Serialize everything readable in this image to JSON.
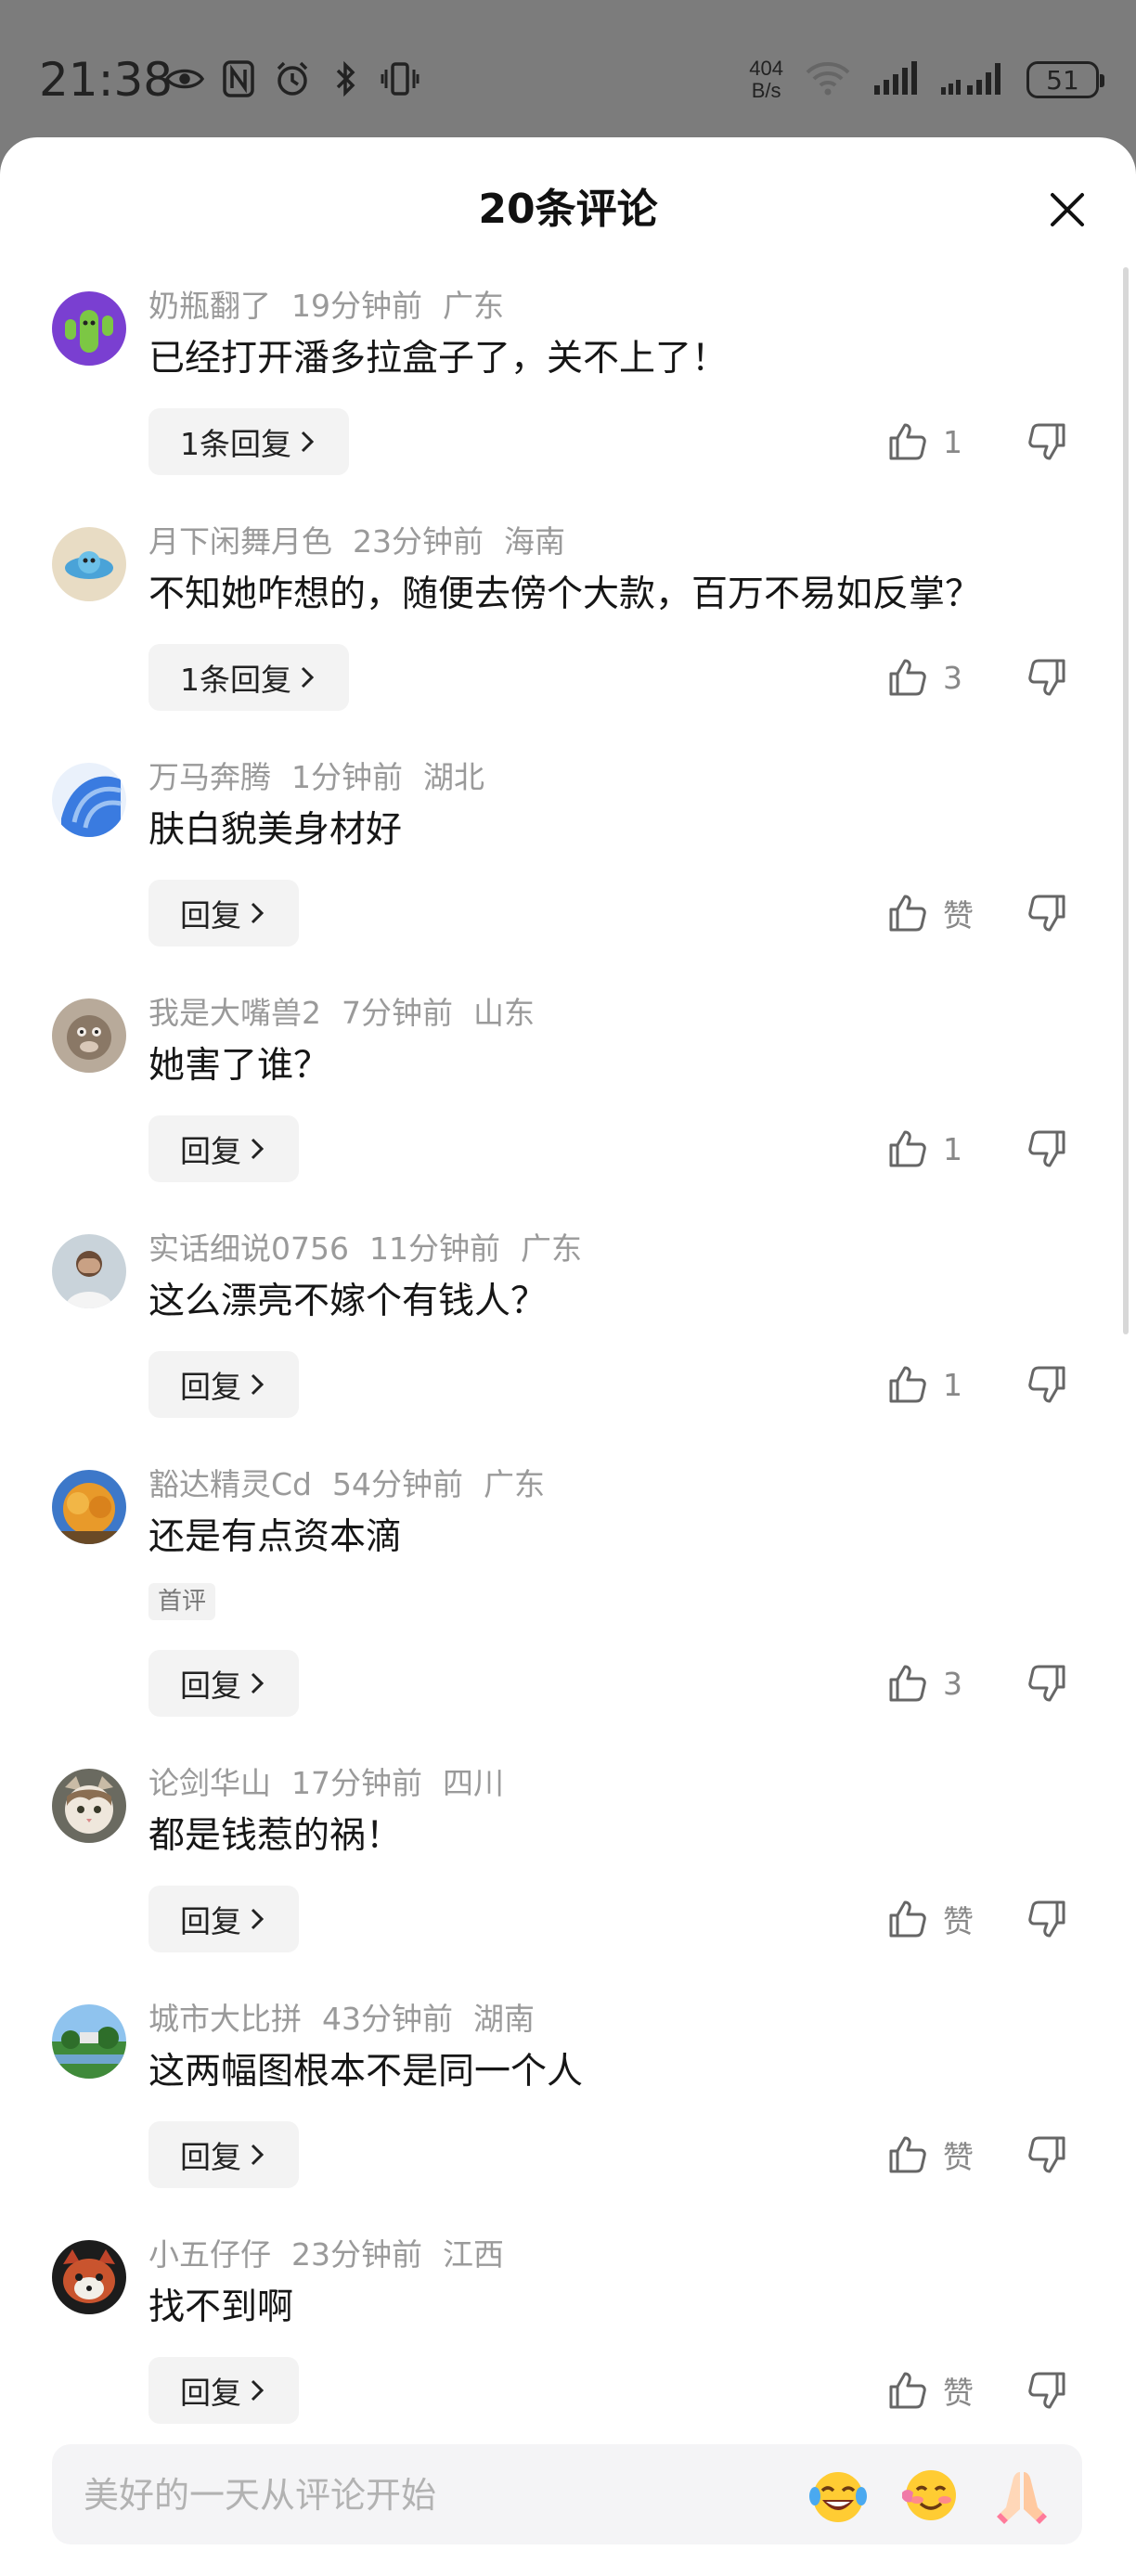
{
  "status_bar": {
    "time": "21:38",
    "net_speed_value": "404",
    "net_speed_unit": "B/s",
    "battery": "51"
  },
  "sheet": {
    "title": "20条评论",
    "input_placeholder": "美好的一天从评论开始"
  },
  "comments": [
    {
      "user": "奶瓶翻了",
      "time": "19分钟前",
      "region": "广东",
      "text": "已经打开潘多拉盒子了，关不上了！",
      "reply_label": "1条回复",
      "likes": "1"
    },
    {
      "user": "月下闲舞月色",
      "time": "23分钟前",
      "region": "海南",
      "text": "不知她咋想的，随便去傍个大款，百万不易如反掌？",
      "reply_label": "1条回复",
      "likes": "3"
    },
    {
      "user": "万马奔腾",
      "time": "1分钟前",
      "region": "湖北",
      "text": "肤白貌美身材好",
      "reply_label": "回复",
      "likes": "赞"
    },
    {
      "user": "我是大嘴兽2",
      "time": "7分钟前",
      "region": "山东",
      "text": "她害了谁？",
      "reply_label": "回复",
      "likes": "1"
    },
    {
      "user": "实话细说0756",
      "time": "11分钟前",
      "region": "广东",
      "text": "这么漂亮不嫁个有钱人？",
      "reply_label": "回复",
      "likes": "1"
    },
    {
      "user": "豁达精灵Cd",
      "time": "54分钟前",
      "region": "广东",
      "text": "还是有点资本滴",
      "tag": "首评",
      "reply_label": "回复",
      "likes": "3"
    },
    {
      "user": "论剑华山",
      "time": "17分钟前",
      "region": "四川",
      "text": "都是钱惹的祸！",
      "reply_label": "回复",
      "likes": "赞"
    },
    {
      "user": "城市大比拼",
      "time": "43分钟前",
      "region": "湖南",
      "text": "这两幅图根本不是同一个人",
      "reply_label": "回复",
      "likes": "赞"
    },
    {
      "user": "小五仔仔",
      "time": "23分钟前",
      "region": "江西",
      "text": "找不到啊",
      "reply_label": "回复",
      "likes": "赞"
    }
  ]
}
